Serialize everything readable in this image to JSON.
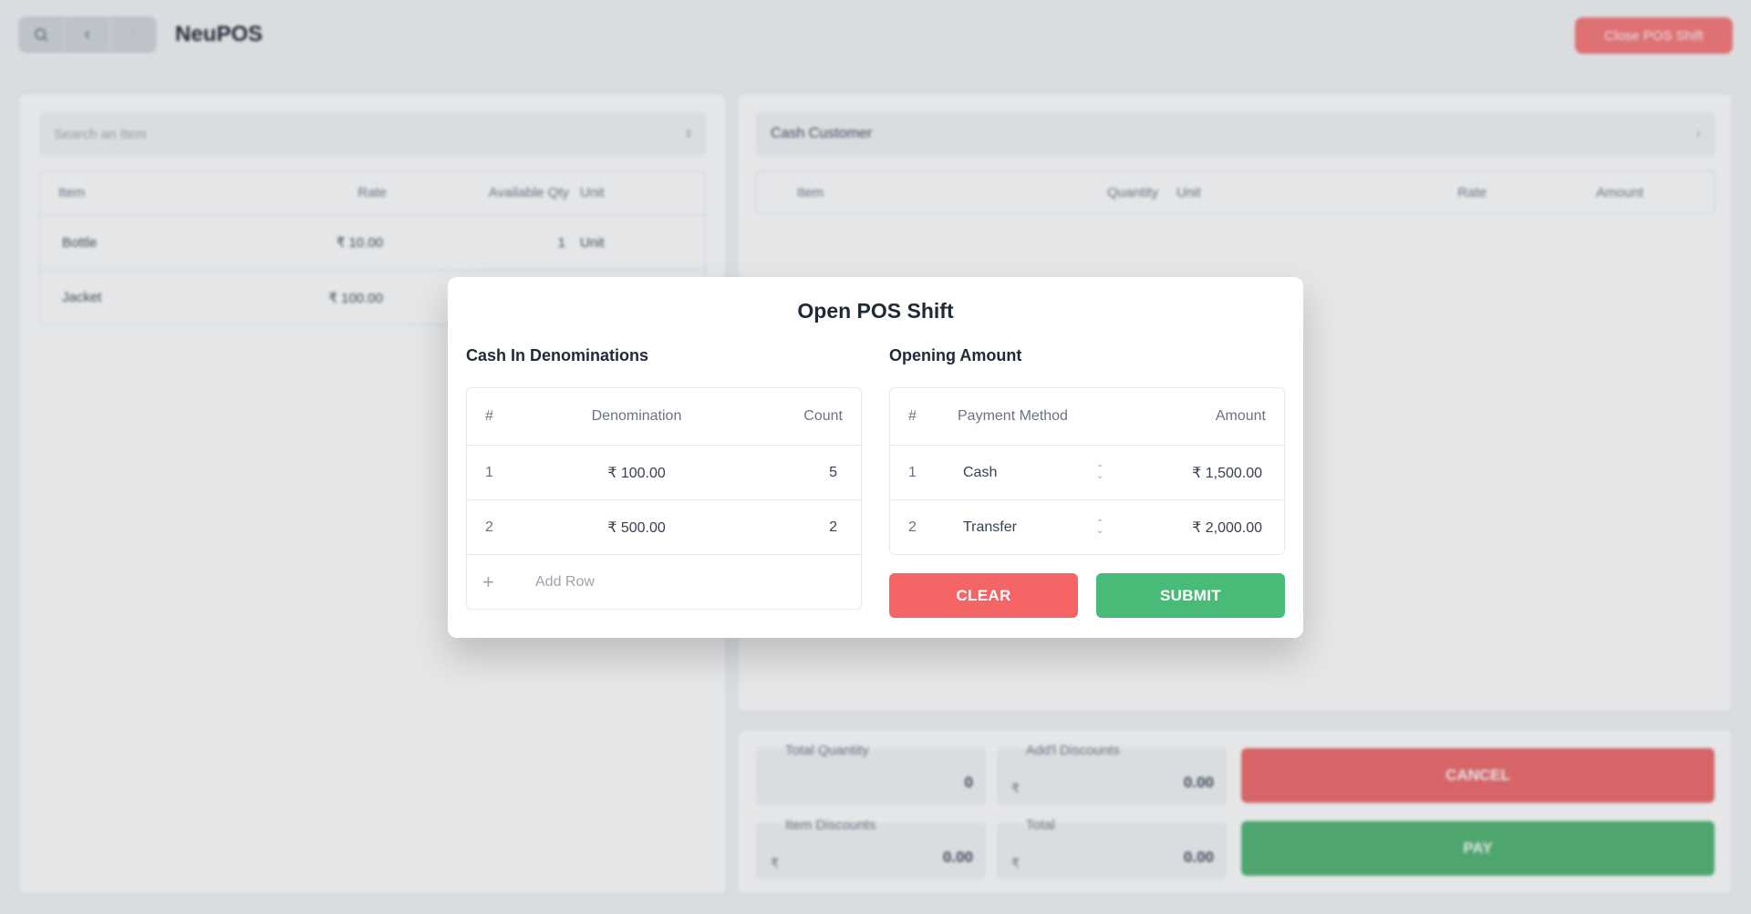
{
  "app": {
    "title": "NeuPOS",
    "close_shift_label": "Close POS Shift",
    "colors": {
      "danger": "#f87171",
      "success": "#48bb78"
    }
  },
  "items_panel": {
    "search_placeholder": "Search an Item",
    "columns": [
      "Item",
      "Rate",
      "Available Qty",
      "Unit"
    ],
    "rows": [
      {
        "item": "Bottle",
        "rate": "₹ 10.00",
        "qty": "1",
        "unit": "Unit"
      },
      {
        "item": "Jacket",
        "rate": "₹ 100.00",
        "qty": "",
        "unit": ""
      }
    ]
  },
  "cart_panel": {
    "customer": "Cash Customer",
    "columns": [
      "Item",
      "Quantity",
      "Unit",
      "Rate",
      "Amount"
    ]
  },
  "totals": {
    "total_quantity_label": "Total Quantity",
    "total_quantity": "0",
    "addl_discounts_label": "Add'l Discounts",
    "addl_discounts": "0.00",
    "item_discounts_label": "Item Discounts",
    "item_discounts": "0.00",
    "total_label": "Total",
    "total": "0.00",
    "currency": "₹",
    "cancel_label": "CANCEL",
    "pay_label": "PAY"
  },
  "modal": {
    "title": "Open POS Shift",
    "denominations": {
      "title": "Cash In Denominations",
      "columns": [
        "#",
        "Denomination",
        "Count"
      ],
      "rows": [
        {
          "idx": "1",
          "denomination": "₹ 100.00",
          "count": "5"
        },
        {
          "idx": "2",
          "denomination": "₹ 500.00",
          "count": "2"
        }
      ],
      "add_row_label": "Add Row"
    },
    "opening": {
      "title": "Opening Amount",
      "columns": [
        "#",
        "Payment Method",
        "Amount"
      ],
      "rows": [
        {
          "idx": "1",
          "method": "Cash",
          "amount": "₹ 1,500.00"
        },
        {
          "idx": "2",
          "method": "Transfer",
          "amount": "₹ 2,000.00"
        }
      ]
    },
    "clear_label": "CLEAR",
    "submit_label": "SUBMIT"
  }
}
